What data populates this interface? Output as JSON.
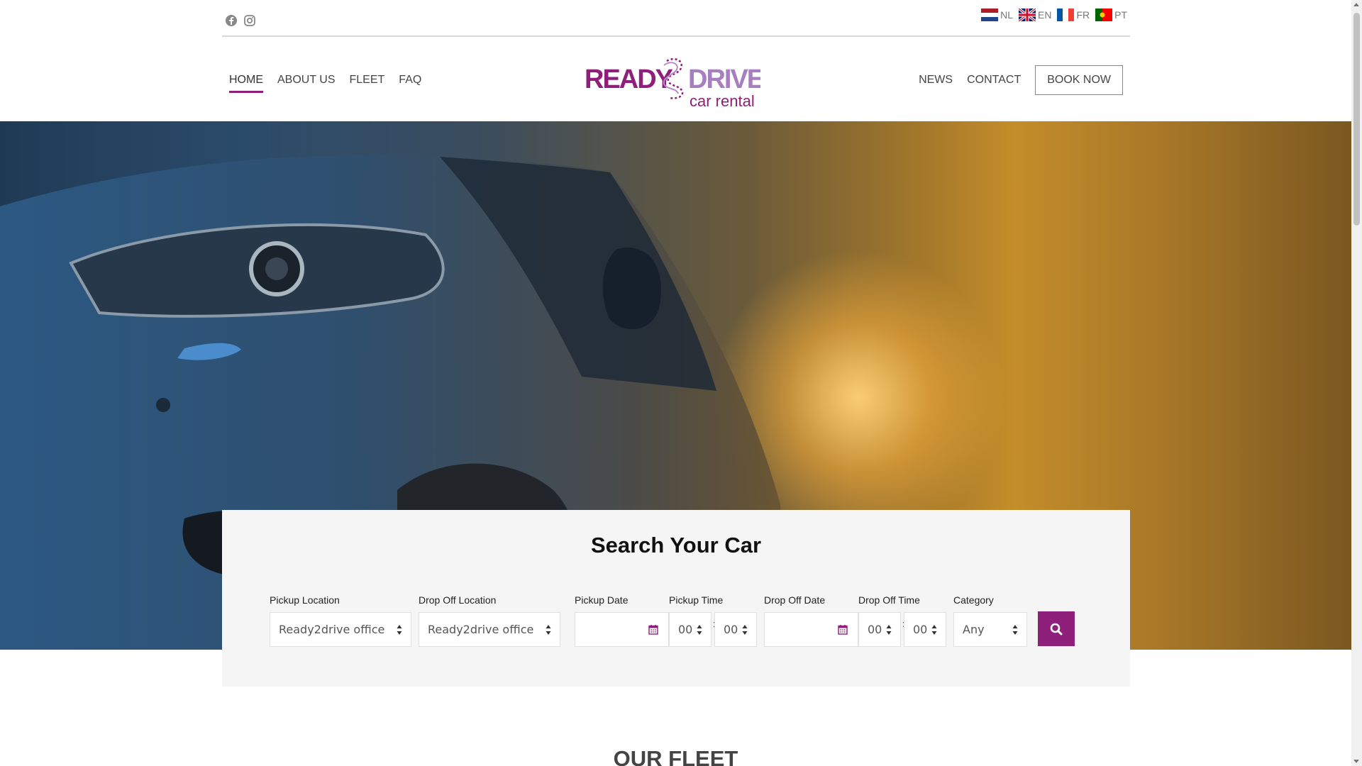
{
  "social": {
    "facebook_icon": "facebook-icon",
    "instagram_icon": "instagram-icon"
  },
  "languages": [
    {
      "code": "NL"
    },
    {
      "code": "EN"
    },
    {
      "code": "FR"
    },
    {
      "code": "PT"
    }
  ],
  "nav": {
    "left": [
      "HOME",
      "ABOUT US",
      "FLEET",
      "FAQ"
    ],
    "right": [
      "NEWS",
      "CONTACT"
    ],
    "book_now": "BOOK NOW",
    "active": "HOME"
  },
  "logo": {
    "word1": "READY",
    "word2": "DRIVE",
    "tagline": "car rental"
  },
  "search": {
    "title": "Search Your Car",
    "pickup_location": {
      "label": "Pickup Location",
      "value": "Ready2drive office"
    },
    "dropoff_location": {
      "label": "Drop Off Location",
      "value": "Ready2drive office"
    },
    "pickup_date": {
      "label": "Pickup Date",
      "value": ""
    },
    "pickup_time": {
      "label": "Pickup Time",
      "hour": "00",
      "minute": "00"
    },
    "dropoff_date": {
      "label": "Drop Off Date",
      "value": ""
    },
    "dropoff_time": {
      "label": "Drop Off Time",
      "hour": "00",
      "minute": "00"
    },
    "category": {
      "label": "Category",
      "value": "Any"
    },
    "time_separator": ":"
  },
  "fleet": {
    "title": "OUR FLEET"
  },
  "colors": {
    "accent": "#8e1f7b",
    "search_bg": "#f5f5f5"
  }
}
